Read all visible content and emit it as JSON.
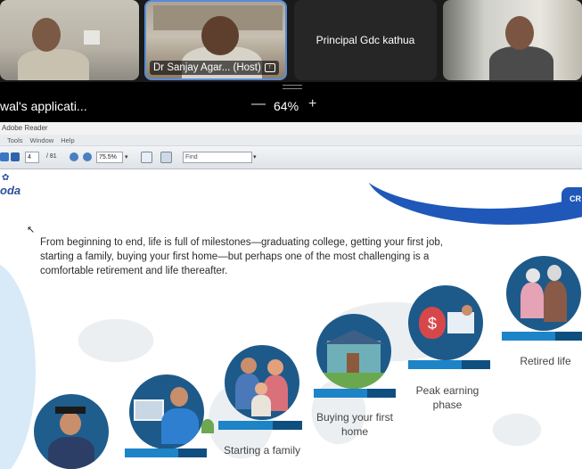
{
  "meeting": {
    "participants": [
      {
        "name": ""
      },
      {
        "name": "Dr Sanjay Agar... (Host)"
      },
      {
        "name": "Principal Gdc kathua"
      },
      {
        "name": ""
      }
    ]
  },
  "share_bar": {
    "title": "wal's applicati...",
    "zoom_minus": "—",
    "zoom_level": "64%",
    "zoom_plus": "+"
  },
  "reader": {
    "title": "Adobe Reader",
    "menu": [
      "Tools",
      "Window",
      "Help"
    ],
    "page_current": "4",
    "page_total": "/ 81",
    "zoom": "75.5%",
    "find_placeholder": "Find"
  },
  "slide": {
    "logo": "oda",
    "badge": "CR",
    "paragraph": "From beginning to end, life is full of milestones—graduating college, getting your first job, starting a family, buying your first home—but perhaps one of the most challenging is a comfortable retirement and life thereafter.",
    "stages": [
      {
        "label": ""
      },
      {
        "label": ""
      },
      {
        "label": "Starting a family"
      },
      {
        "label": "Buying your first home"
      },
      {
        "label": "Peak earning phase"
      },
      {
        "label": "Retired life"
      }
    ]
  },
  "colors": {
    "accent_blue": "#1f58b8",
    "stage_blue": "#1d84c7",
    "host_border": "#5a8bd6"
  }
}
